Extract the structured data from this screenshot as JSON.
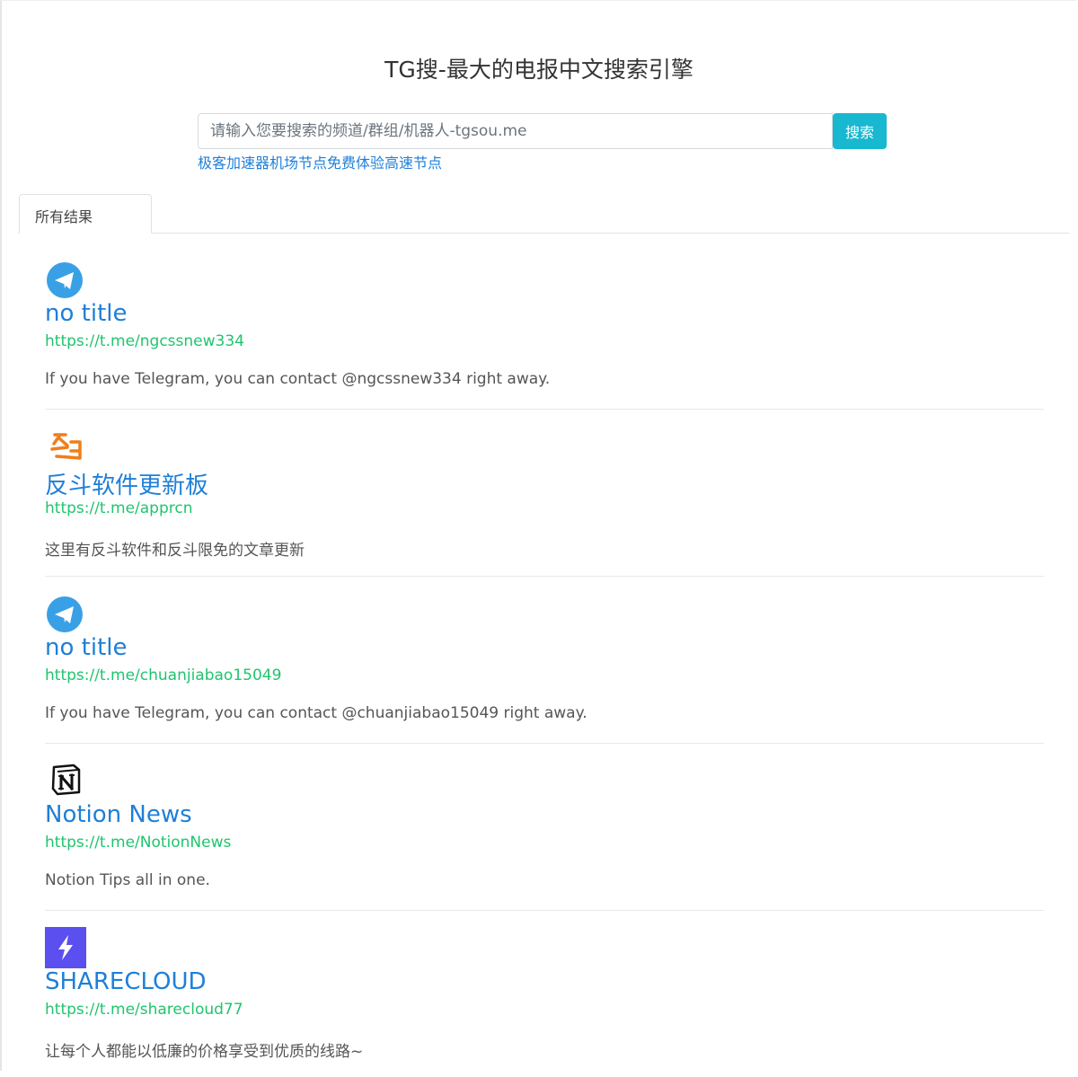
{
  "header": {
    "site_title": "TG搜-最大的电报中文搜索引擎"
  },
  "search": {
    "placeholder": "请输入您要搜索的频道/群组/机器人-tgsou.me",
    "button_label": "搜索",
    "promo_link": "极客加速器机场节点免费体验高速节点"
  },
  "tabs": {
    "all_results": "所有结果"
  },
  "colors": {
    "accent_button": "#17b8d0",
    "title_link": "#1e7fd8",
    "url_green": "#20c46e",
    "telegram_blue": "#3aa0e6",
    "sharecloud_purple": "#5b4ff0",
    "apprcn_orange": "#f07e1b"
  },
  "results": [
    {
      "icon": "telegram-icon",
      "title": "no title",
      "url": "https://t.me/ngcssnew334",
      "description": "If you have Telegram, you can contact @ngcssnew334 right away."
    },
    {
      "icon": "apprcn-logo-icon",
      "title": "反斗软件更新板",
      "url": "https://t.me/apprcn",
      "description": "这里有反斗软件和反斗限免的文章更新"
    },
    {
      "icon": "telegram-icon",
      "title": "no title",
      "url": "https://t.me/chuanjiabao15049",
      "description": "If you have Telegram, you can contact @chuanjiabao15049 right away."
    },
    {
      "icon": "notion-logo-icon",
      "title": "Notion News",
      "url": "https://t.me/NotionNews",
      "description": "Notion Tips all in one."
    },
    {
      "icon": "lightning-bolt-icon",
      "title": "SHARECLOUD",
      "url": "https://t.me/sharecloud77",
      "description": "让每个人都能以低廉的价格享受到优质的线路~"
    }
  ]
}
